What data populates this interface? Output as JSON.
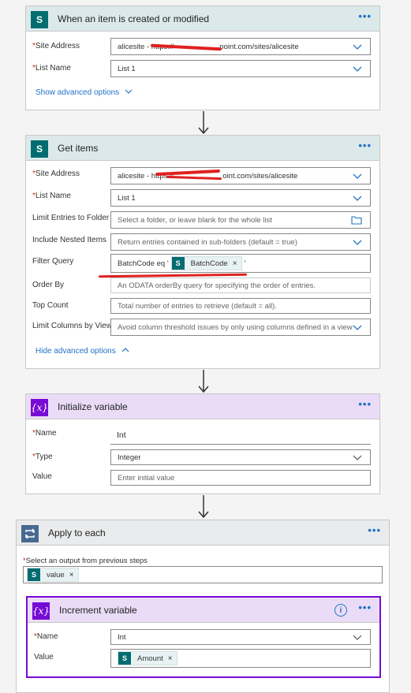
{
  "trigger": {
    "title": "When an item is created or modified",
    "site_label": "Site Address",
    "site_value": "alicesite - https://",
    "site_value_end": "point.com/sites/alicesite",
    "list_label": "List Name",
    "list_value": "List 1",
    "advanced_link": "Show advanced options"
  },
  "get_items": {
    "title": "Get items",
    "site_label": "Site Address",
    "site_value": "alicesite - https://",
    "site_value_end": "oint.com/sites/alicesite",
    "list_label": "List Name",
    "list_value": "List 1",
    "limit_label": "Limit Entries to Folder",
    "limit_placeholder": "Select a folder, or leave blank for the whole list",
    "nested_label": "Include Nested Items",
    "nested_value": "Return entries contained in sub-folders (default = true)",
    "filter_label": "Filter Query",
    "filter_text": "BatchCode eq '",
    "filter_token": "BatchCode",
    "filter_after": "'",
    "order_label": "Order By",
    "order_placeholder": "An ODATA orderBy query for specifying the order of entries.",
    "top_label": "Top Count",
    "top_placeholder": "Total number of entries to retrieve (default = all).",
    "limitcol_label": "Limit Columns by View",
    "limitcol_value": "Avoid column threshold issues by only using columns defined in a view",
    "advanced_link": "Hide advanced options"
  },
  "init_var": {
    "title": "Initialize variable",
    "icon_text": "{x}",
    "name_label": "Name",
    "name_value": "Int",
    "type_label": "Type",
    "type_value": "Integer",
    "value_label": "Value",
    "value_placeholder": "Enter initial value"
  },
  "apply_each": {
    "title": "Apply to each",
    "select_label": "Select an output from previous steps",
    "token": "value"
  },
  "increment": {
    "title": "Increment variable",
    "icon_text": "{x}",
    "info": "i",
    "name_label": "Name",
    "name_value": "Int",
    "value_label": "Value",
    "value_token": "Amount"
  },
  "common": {
    "required_mark": "*",
    "more": "•••",
    "remove": "×",
    "sp_letter": "S"
  },
  "colors": {
    "accent": "#2273c5",
    "sharepoint": "#036c70",
    "variable": "#770bd6",
    "loop": "#486991",
    "redaction": "#e02020"
  },
  "icons": [
    "sharepoint-icon",
    "variable-icon",
    "loop-icon",
    "chevron-down-icon",
    "folder-icon",
    "info-icon",
    "more-icon",
    "arrow-down-icon",
    "close-icon"
  ]
}
